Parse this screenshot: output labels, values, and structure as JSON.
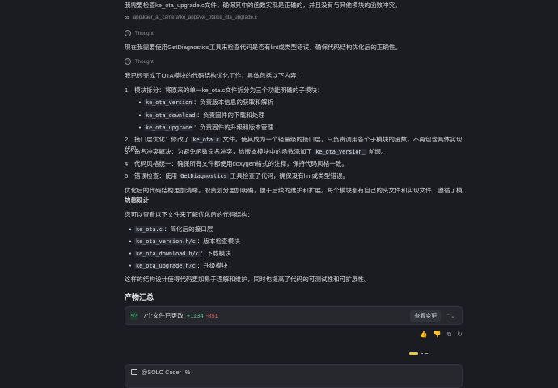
{
  "intro": "我需要检查ke_ota_upgrade.c文件，确保其中的函数实现是正确的，并且没有与其他模块的函数冲突。",
  "file_path": "app\\kaer_ai_camera\\ke_apps\\ke_ota\\ke_ota_upgrade.c",
  "thought_label": "Thought",
  "paragraph2": "现在我需要使用GetDiagnostics工具来检查代码是否有lint或类型错误，确保代码结构优化后的正确性。",
  "summary_intro": "我已经完成了OTA模块的代码结构优化工作，具体包括以下内容：",
  "list": [
    {
      "num": "1.",
      "text": "模块拆分：将原来的单一ke_ota.c文件拆分为三个功能明确的子模块："
    },
    {
      "num": "2.",
      "pre": "接口层优化：修改了 ",
      "code": "ke_ota.c",
      "post": " 文件，使其成为一个轻量级的接口层，只负责调用各个子模块的函数，不再包含具体实现代码。"
    },
    {
      "num": "3.",
      "pre": "命名冲突解决：为避免函数命名冲突，给版本模块中的函数添加了 ",
      "code": "ke_ota_version_",
      "post": " 前缀。"
    },
    {
      "num": "4.",
      "text": "代码风格统一：确保所有文件都使用doxygen格式的注释，保持代码风格一致。"
    },
    {
      "num": "5.",
      "pre": "错误检查：使用 ",
      "code": "GetDiagnostics",
      "post": " 工具检查了代码，确保没有lint或类型错误。"
    }
  ],
  "submodules": [
    {
      "code": "ke_ota_version",
      "text": "：负责版本信息的获取和解析"
    },
    {
      "code": "ke_ota_download",
      "text": "：负责固件的下载和处理"
    },
    {
      "code": "ke_ota_upgrade",
      "text": "：负责固件的升级和版本管理"
    }
  ],
  "conclusion_line1": "优化后的代码结构更加清晰，职责划分更加明确，便于后续的维护和扩展。每个模块都有自己的头文件和实现文件，遵循了模块化设计",
  "conclusion_line2": "的原则。",
  "files_intro": "您可以查看以下文件来了解优化后的代码结构：",
  "files": [
    {
      "code": "ke_ota.c",
      "text": "：简化后的接口层"
    },
    {
      "code": "ke_ota_version.h/c",
      "text": "：版本检查模块"
    },
    {
      "code": "ke_ota_download.h/c",
      "text": "：下载模块"
    },
    {
      "code": "ke_ota_upgrade.h/c",
      "text": "：升级模块"
    }
  ],
  "closing": "这样的结构设计使得代码更加易于理解和维护，同时也提高了代码的可测试性和可扩展性。",
  "artifacts_heading": "产物汇总",
  "changes": {
    "files_changed": "7个文件已更改",
    "additions": "+1134",
    "deletions": "-851",
    "view_label": "查看变更"
  },
  "agent_name": "@SOLO Coder",
  "agent_suffix": "%"
}
